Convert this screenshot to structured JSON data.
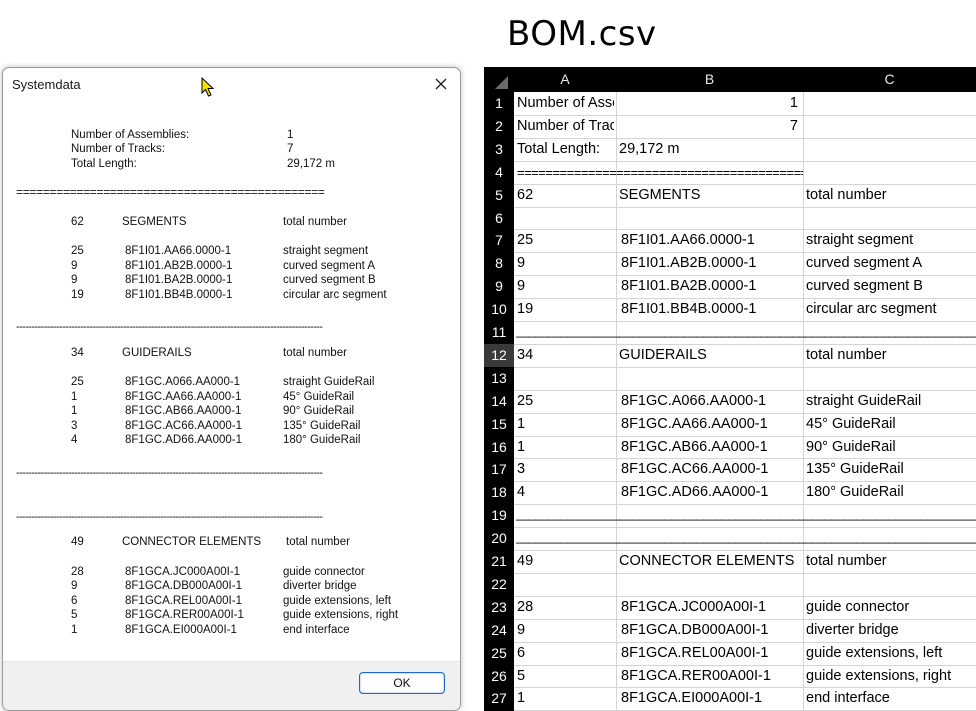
{
  "dialog": {
    "title": "Systemdata",
    "ok_label": "OK",
    "summary": {
      "assemblies_label": "Number of Assemblies:",
      "assemblies_value": "1",
      "tracks_label": "Number of Tracks:",
      "tracks_value": "7",
      "length_label": "Total Length:",
      "length_value": "29,172 m"
    },
    "double_separator": "==============================================",
    "dash_separator": "----------------------------------------------------------------------------------------------------",
    "segments": {
      "count": "62",
      "heading": "SEGMENTS",
      "col": "total number",
      "rows": [
        {
          "qty": "25",
          "part": "8F1I01.AA66.0000-1",
          "desc": "straight segment"
        },
        {
          "qty": "9",
          "part": "8F1I01.AB2B.0000-1",
          "desc": "curved segment A"
        },
        {
          "qty": "9",
          "part": "8F1I01.BA2B.0000-1",
          "desc": "curved segment B"
        },
        {
          "qty": "19",
          "part": "8F1I01.BB4B.0000-1",
          "desc": "circular arc segment"
        }
      ]
    },
    "guiderails": {
      "count": "34",
      "heading": "GUIDERAILS",
      "col": "total number",
      "rows": [
        {
          "qty": "25",
          "part": "8F1GC.A066.AA000-1",
          "desc": "straight GuideRail"
        },
        {
          "qty": "1",
          "part": "8F1GC.AA66.AA000-1",
          "desc": "45° GuideRail"
        },
        {
          "qty": "1",
          "part": "8F1GC.AB66.AA000-1",
          "desc": "90° GuideRail"
        },
        {
          "qty": "3",
          "part": "8F1GC.AC66.AA000-1",
          "desc": "135° GuideRail"
        },
        {
          "qty": "4",
          "part": "8F1GC.AD66.AA000-1",
          "desc": "180° GuideRail"
        }
      ]
    },
    "connectors": {
      "count": "49",
      "heading": "CONNECTOR ELEMENTS",
      "col": "total number",
      "rows": [
        {
          "qty": "28",
          "part": "8F1GCA.JC000A00I-1",
          "desc": "guide connector"
        },
        {
          "qty": "9",
          "part": "8F1GCA.DB000A00I-1",
          "desc": "diverter bridge"
        },
        {
          "qty": "6",
          "part": "8F1GCA.REL00A00I-1",
          "desc": "guide extensions, left"
        },
        {
          "qty": "5",
          "part": "8F1GCA.RER00A00I-1",
          "desc": "guide extensions, right"
        },
        {
          "qty": "1",
          "part": "8F1GCA.EI000A00I-1",
          "desc": "end interface"
        }
      ]
    }
  },
  "sheet": {
    "title": "BOM.csv",
    "columns": [
      "A",
      "B",
      "C"
    ],
    "selected_row": "12",
    "rows": [
      {
        "n": "1",
        "a": "Number of Assemblies:",
        "b": "1",
        "c": ""
      },
      {
        "n": "2",
        "a": "Number of Tracks:",
        "b": "7",
        "c": ""
      },
      {
        "n": "3",
        "a": "Total Length:",
        "b": "29,172 m",
        "c": ""
      },
      {
        "n": "4",
        "a": "=============================================",
        "b": "",
        "c": ""
      },
      {
        "n": "5",
        "a": "62",
        "b": "SEGMENTS",
        "c": "total number"
      },
      {
        "n": "6",
        "a": "",
        "b": "",
        "c": ""
      },
      {
        "n": "7",
        "a": "25",
        "b": "8F1I01.AA66.0000-1",
        "c": "straight segment"
      },
      {
        "n": "8",
        "a": "9",
        "b": "8F1I01.AB2B.0000-1",
        "c": "curved segment A"
      },
      {
        "n": "9",
        "a": "9",
        "b": "8F1I01.BA2B.0000-1",
        "c": "curved segment B"
      },
      {
        "n": "10",
        "a": "19",
        "b": "8F1I01.BB4B.0000-1",
        "c": "circular arc segment"
      },
      {
        "n": "11",
        "a": "",
        "b": "",
        "c": ""
      },
      {
        "n": "12",
        "a": "34",
        "b": "GUIDERAILS",
        "c": "total number"
      },
      {
        "n": "13",
        "a": "",
        "b": "",
        "c": ""
      },
      {
        "n": "14",
        "a": "25",
        "b": "8F1GC.A066.AA000-1",
        "c": "straight GuideRail"
      },
      {
        "n": "15",
        "a": "1",
        "b": "8F1GC.AA66.AA000-1",
        "c": "45° GuideRail"
      },
      {
        "n": "16",
        "a": "1",
        "b": "8F1GC.AB66.AA000-1",
        "c": "90° GuideRail"
      },
      {
        "n": "17",
        "a": "3",
        "b": "8F1GC.AC66.AA000-1",
        "c": "135° GuideRail"
      },
      {
        "n": "18",
        "a": "4",
        "b": "8F1GC.AD66.AA000-1",
        "c": "180° GuideRail"
      },
      {
        "n": "19",
        "a": "",
        "b": "",
        "c": ""
      },
      {
        "n": "20",
        "a": "",
        "b": "",
        "c": ""
      },
      {
        "n": "21",
        "a": "49",
        "b": "CONNECTOR ELEMENTS",
        "c": "total number"
      },
      {
        "n": "22",
        "a": "",
        "b": "",
        "c": ""
      },
      {
        "n": "23",
        "a": "28",
        "b": "8F1GCA.JC000A00I-1",
        "c": "guide connector"
      },
      {
        "n": "24",
        "a": "9",
        "b": "8F1GCA.DB000A00I-1",
        "c": "diverter bridge"
      },
      {
        "n": "25",
        "a": "6",
        "b": "8F1GCA.REL00A00I-1",
        "c": "guide extensions, left"
      },
      {
        "n": "26",
        "a": "5",
        "b": "8F1GCA.RER00A00I-1",
        "c": "guide extensions, right"
      },
      {
        "n": "27",
        "a": "1",
        "b": "8F1GCA.EI000A00I-1",
        "c": "end interface"
      }
    ],
    "wide_dash": "__________________________________________________________________________________________",
    "colors": {
      "header_bg": "#000000",
      "selected_rownum": "#3a3a3a",
      "grid": "#d4d4d4"
    }
  }
}
